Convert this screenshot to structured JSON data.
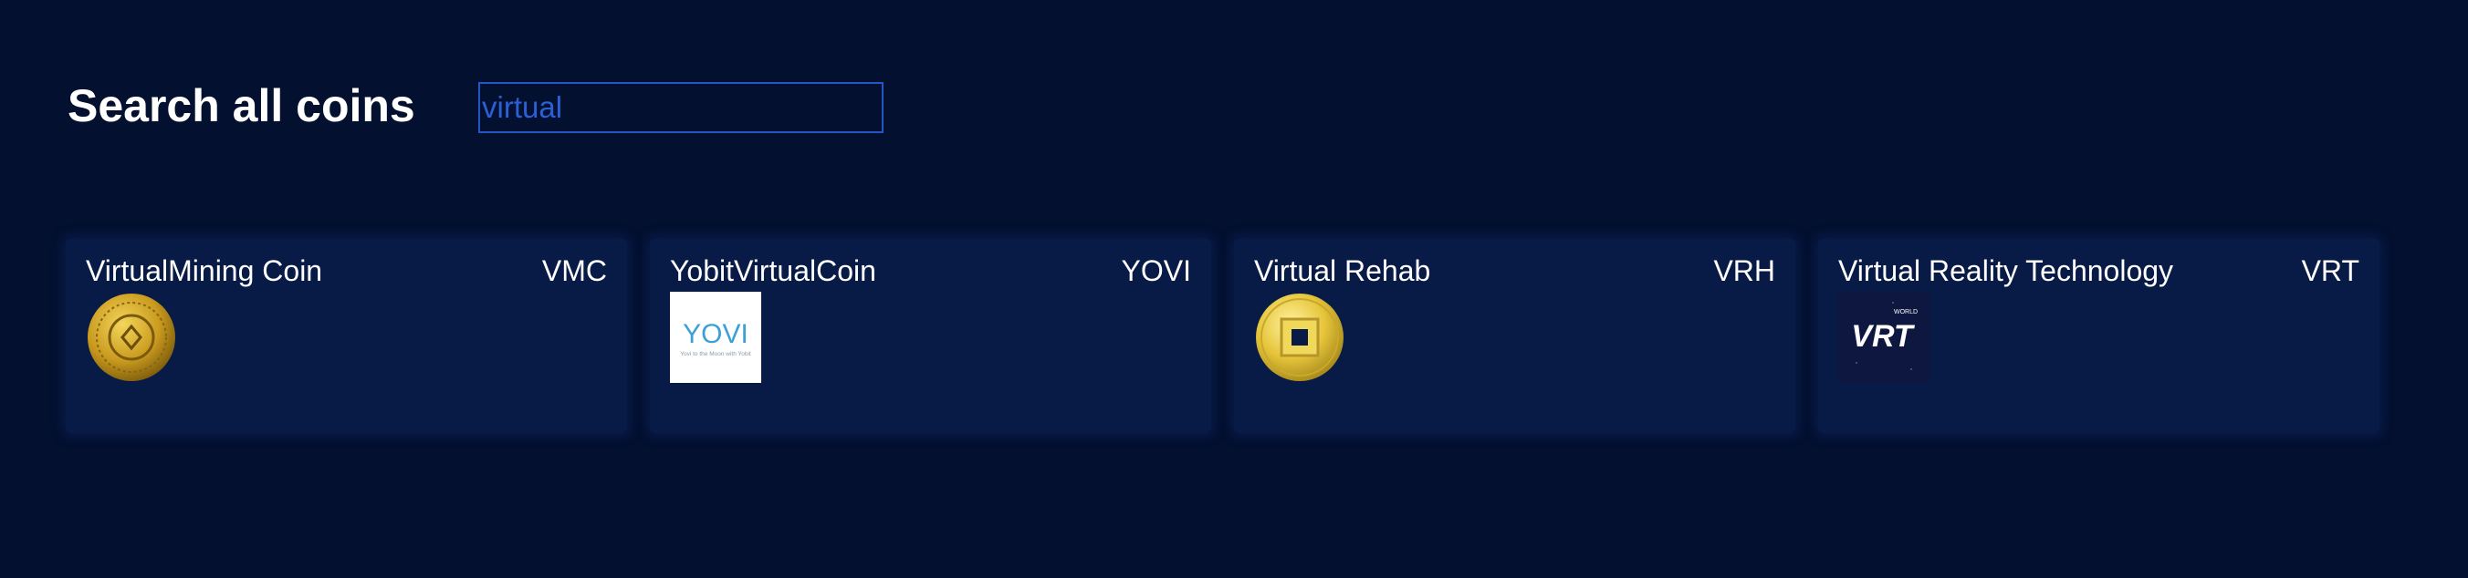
{
  "search": {
    "title": "Search all coins",
    "value": "virtual"
  },
  "coins": [
    {
      "name": "VirtualMining Coin",
      "symbol": "VMC",
      "logo_icon": "vmc-coin-icon"
    },
    {
      "name": "YobitVirtualCoin",
      "symbol": "YOVI",
      "logo_icon": "yovi-logo-icon",
      "logo_text": "YOVI",
      "logo_tagline": "Yovi to the Moon with Yobit"
    },
    {
      "name": "Virtual Rehab",
      "symbol": "VRH",
      "logo_icon": "vrh-coin-icon"
    },
    {
      "name": "Virtual Reality Technology",
      "symbol": "VRT",
      "logo_icon": "vrt-logo-icon",
      "logo_text": "VRT",
      "logo_tagline": "WORLD"
    }
  ],
  "colors": {
    "background": "#031030",
    "card": "#081a46",
    "input_border": "#2456c6",
    "input_text": "#2c5fd6"
  }
}
